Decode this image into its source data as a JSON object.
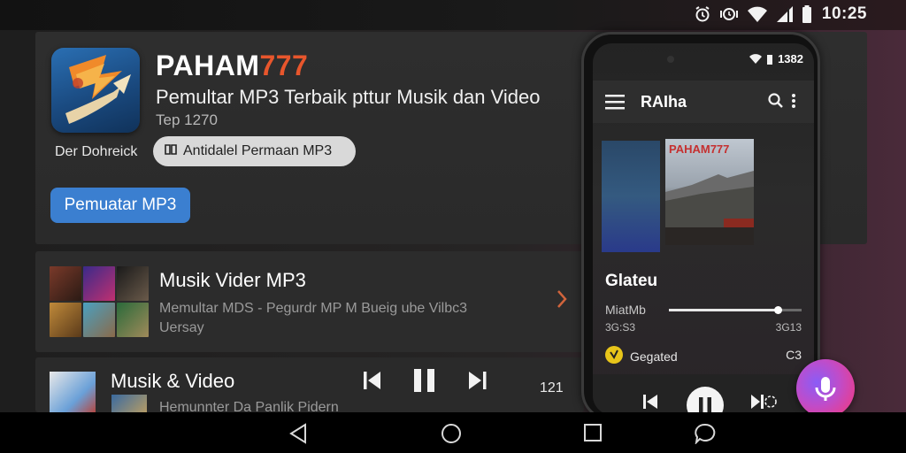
{
  "status_bar": {
    "time": "10:25",
    "icons": [
      "alarm-icon",
      "vibrate-icon",
      "wifi-icon",
      "signal-icon",
      "battery-icon"
    ]
  },
  "header": {
    "app_name_prefix": "PAHAM",
    "app_name_suffix": "777",
    "subtitle": "Pemultar MP3 Terbaik pttur Musik dan Video",
    "meta": "Tep 1270",
    "developer": "Der Dohreick",
    "chip_label": "Antidalel Permaan MP3",
    "primary_button": "Pemuatar MP3"
  },
  "list": {
    "items": [
      {
        "title": "Musik Vider MP3",
        "desc_line1": "Memultar MDS - Pegurdr MP M Bueig ube Vilbc3",
        "desc_line2": "Uersay"
      },
      {
        "title": "Musik & Video",
        "desc_line1": "Hemunnter Da Panlik Pidern"
      }
    ]
  },
  "mini_player": {
    "time": "121"
  },
  "phone": {
    "status_text": "1382",
    "appbar_title": "RAIha",
    "art_label": "PAHAM777",
    "song_title": "Glateu",
    "artist": "MiatMb",
    "progress": 0.82,
    "time_elapsed": "3G:S3",
    "time_total": "3G13",
    "device_label": "Gegated",
    "device_badge": "C3"
  },
  "colors": {
    "accent_orange": "#e8562c",
    "primary_blue": "#3b7fd0",
    "fab_purple": "#b04fd0"
  }
}
